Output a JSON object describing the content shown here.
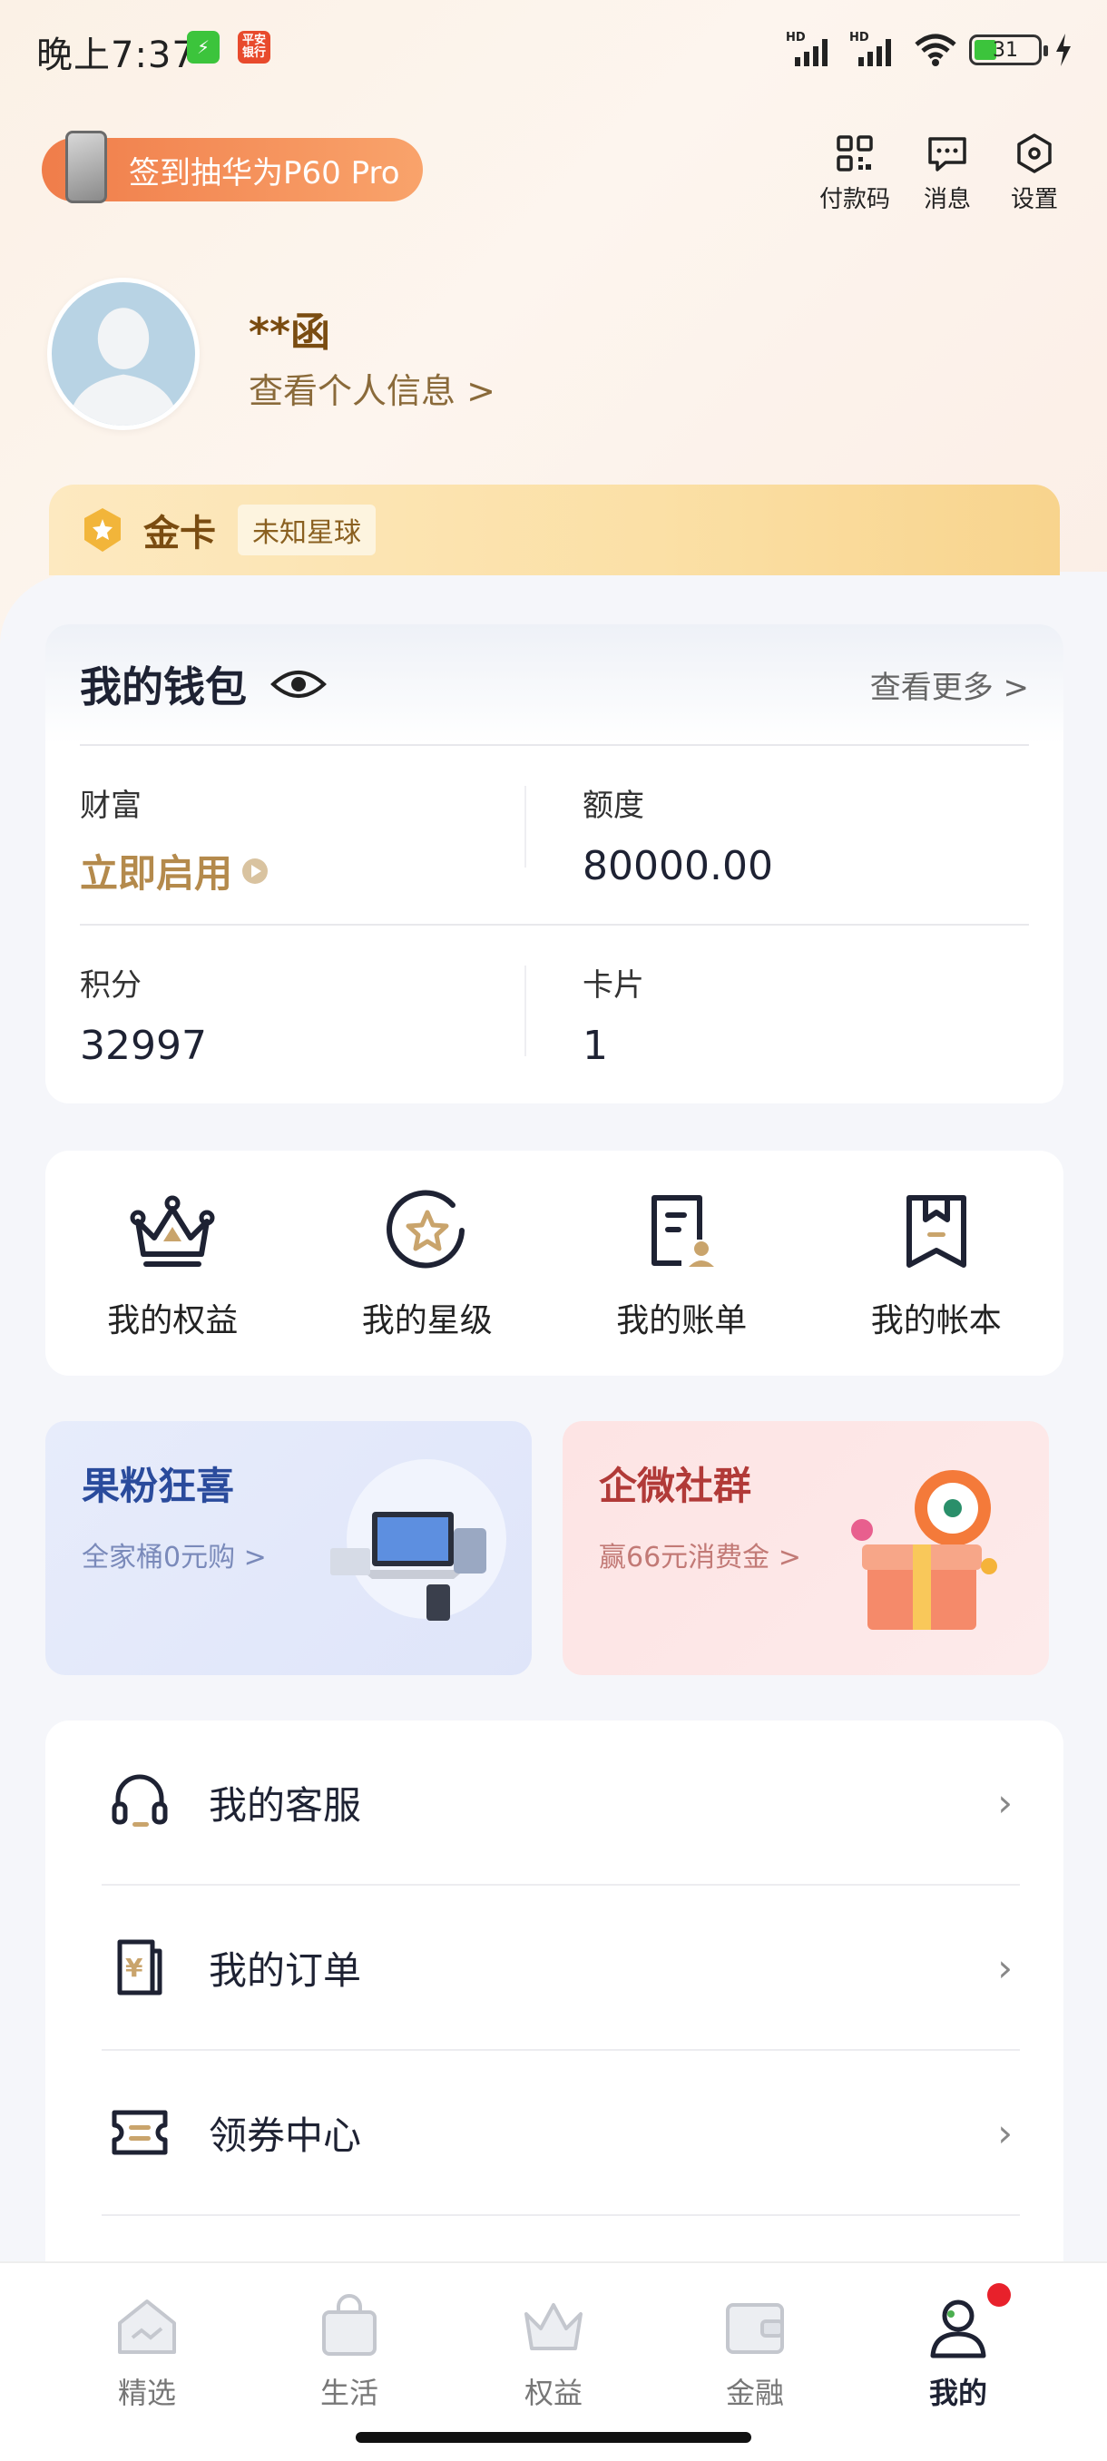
{
  "status": {
    "time": "晚上7:37",
    "battery": "31",
    "signal1": "HD",
    "signal2": "HD"
  },
  "promo": {
    "label": "签到抽华为P60 Pro"
  },
  "top_actions": [
    {
      "label": "付款码",
      "icon": "qr-code-icon"
    },
    {
      "label": "消息",
      "icon": "message-icon"
    },
    {
      "label": "设置",
      "icon": "settings-icon"
    }
  ],
  "profile": {
    "name": "**函",
    "view_info": "查看个人信息 >"
  },
  "membership": {
    "level": "金卡",
    "badge": "未知星球"
  },
  "wallet": {
    "title": "我的钱包",
    "more": "查看更多 >",
    "items": [
      {
        "label": "财富",
        "value": "立即启用"
      },
      {
        "label": "额度",
        "value": "80000.00"
      },
      {
        "label": "积分",
        "value": "32997"
      },
      {
        "label": "卡片",
        "value": "1"
      }
    ]
  },
  "quick": [
    {
      "label": "我的权益",
      "icon": "crown-icon"
    },
    {
      "label": "我的星级",
      "icon": "star-badge-icon"
    },
    {
      "label": "我的账单",
      "icon": "bill-icon"
    },
    {
      "label": "我的帐本",
      "icon": "ledger-icon"
    }
  ],
  "banners": [
    {
      "title": "果粉狂喜",
      "sub": "全家桶0元购 >"
    },
    {
      "title": "企微社群",
      "sub": "赢66元消费金 >"
    }
  ],
  "menu": [
    {
      "label": "我的客服",
      "icon": "headset-icon"
    },
    {
      "label": "我的订单",
      "icon": "order-icon"
    },
    {
      "label": "领券中心",
      "icon": "coupon-icon"
    }
  ],
  "tabs": [
    {
      "label": "精选",
      "icon": "home-icon"
    },
    {
      "label": "生活",
      "icon": "bag-icon"
    },
    {
      "label": "权益",
      "icon": "crown-tab-icon"
    },
    {
      "label": "金融",
      "icon": "wallet-icon"
    },
    {
      "label": "我的",
      "icon": "user-icon"
    }
  ]
}
